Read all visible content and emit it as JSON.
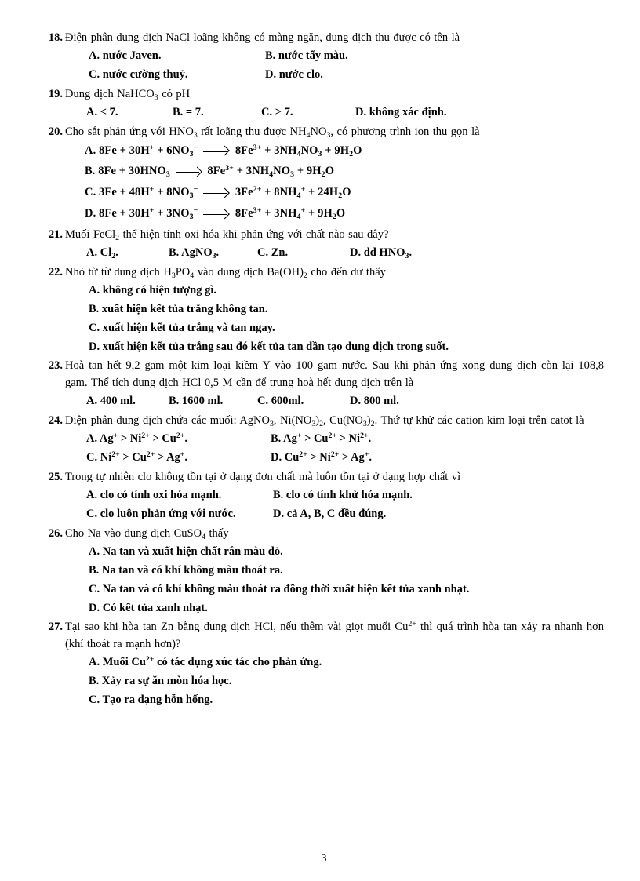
{
  "document": {
    "page_number": "3",
    "language": "vi"
  },
  "questions": [
    {
      "number": "18.",
      "text": "Điện phân dung dịch NaCl loãng không có màng ngăn, dung dịch thu được có tên là",
      "layout": "2col",
      "options": [
        "A. nước Javen.",
        "B. nước tẩy màu.",
        "C. nước cường thuỷ.",
        "D. nước clo."
      ]
    },
    {
      "number": "19.",
      "text_html": "Dung dịch NaHCO<sub>3</sub> có pH",
      "layout": "4col",
      "options": [
        "A. < 7.",
        "B. = 7.",
        "C. > 7.",
        "D. không xác định."
      ]
    },
    {
      "number": "20.",
      "text_html": "Cho sắt phản ứng với HNO<sub>3</sub> rất loãng thu được NH<sub>4</sub>NO<sub>3</sub>, có phương trình ion thu gọn là",
      "layout": "equations",
      "options_html": [
        "A.  8Fe + 30H<sup>+</sup> + 6NO<sub>3</sub><sup>−</sup> <span class=\"arrow\"></span> 8Fe<sup>3+</sup> + 3NH<sub>4</sub>NO<sub>3</sub> + 9H<sub>2</sub>O",
        "B.  8Fe + 30HNO<sub>3</sub> <span class=\"arrow short\"></span> 8Fe<sup>3+</sup> + 3NH<sub>4</sub>NO<sub>3</sub> + 9H<sub>2</sub>O",
        "C.  3Fe + 48H<sup>+</sup> + 8NO<sub>3</sub><sup>−</sup> <span class=\"arrow\"></span> 3Fe<sup>2+</sup> + 8NH<sub>4</sub><sup>+</sup> + 24H<sub>2</sub>O",
        "D.  8Fe + 30H<sup>+</sup> + 3NO<sub>3</sub><sup>−</sup> <span class=\"arrow\"></span> 8Fe<sup>3+</sup> + 3NH<sub>4</sub><sup>+</sup> + 9H<sub>2</sub>O"
      ]
    },
    {
      "number": "21.",
      "text_html": "Muối FeCl<sub>2</sub> thể hiện tính oxi hóa khi phản ứng với chất nào sau đây?",
      "layout": "4col-tight",
      "options_html": [
        "A. Cl<sub>2</sub>.",
        "B. AgNO<sub>3</sub>.",
        "C. Zn.",
        "D. dd HNO<sub>3</sub>."
      ]
    },
    {
      "number": "22.",
      "text_html": "Nhỏ từ từ dung dịch H<sub>3</sub>PO<sub>4</sub> vào dung dịch Ba(OH)<sub>2</sub> cho đến dư thấy",
      "layout": "1col",
      "options": [
        "A. không có hiện tượng gì.",
        "B. xuất hiện kết tủa trắng không tan.",
        "C. xuất hiện kết tủa trắng và tan ngay.",
        "D. xuất hiện kết tủa trắng sau đó kết tủa tan dần tạo dung dịch trong suốt."
      ]
    },
    {
      "number": "23.",
      "text": "Hoà tan hết 9,2 gam một kim loại kiềm Y vào 100 gam nước. Sau khi phản ứng xong dung dịch còn lại 108,8 gam. Thể tích dung dịch HCl 0,5 M cần để trung hoà hết dung dịch trên là",
      "layout": "4col-tight",
      "options": [
        "A. 400 ml.",
        "B. 1600 ml.",
        "C. 600ml.",
        "D. 800 ml."
      ]
    },
    {
      "number": "24.",
      "text_html": "Điện phân dung dịch chứa các muối:  AgNO<sub>3</sub>, Ni(NO<sub>3</sub>)<sub>2</sub>, Cu(NO<sub>3</sub>)<sub>2</sub>. Thứ tự khử các cation kim loại trên catot là",
      "layout": "2col-wide",
      "options_html": [
        "A. Ag<sup>+</sup> > Ni<sup>2+</sup> > Cu<sup>2+</sup>.",
        "B. Ag<sup>+</sup> > Cu<sup>2+</sup> > Ni<sup>2+</sup>.",
        "C. Ni<sup>2+</sup> > Cu<sup>2+</sup> > Ag<sup>+</sup>.",
        "D. Cu<sup>2+</sup> > Ni<sup>2+</sup> > Ag<sup>+</sup>."
      ]
    },
    {
      "number": "25.",
      "text": "Trong tự nhiên clo không tồn tại ở dạng đơn chất mà luôn tồn tại ở dạng hợp chất vì",
      "layout": "2col-narrow",
      "options": [
        "A. clo có tính oxi hóa mạnh.",
        "B. clo có tính khử hóa mạnh.",
        "C. clo luôn phản ứng với nước.",
        "D. cả A, B, C đều đúng."
      ]
    },
    {
      "number": "26.",
      "text_html": "Cho Na vào dung dịch CuSO<sub>4</sub> thấy",
      "layout": "1col",
      "options": [
        "A. Na tan và xuất hiện chất rắn màu đỏ.",
        "B. Na tan và có khí không màu thoát ra.",
        "C. Na tan và có khí không màu thoát ra đồng thời xuất hiện kết tủa xanh nhạt.",
        "D. Có kết tủa xanh nhạt."
      ]
    },
    {
      "number": "27.",
      "text_html": "Tại sao khi hòa tan Zn bằng dung dịch HCl, nếu thêm vài giọt muối Cu<sup>2+</sup> thì quá trình hòa tan xảy ra nhanh hơn (khí thoát ra mạnh hơn)?",
      "layout": "1col",
      "options_html": [
        "A. Muối Cu<sup>2+</sup> có tác dụng xúc tác cho phản ứng.",
        "B. Xảy ra sự ăn mòn hóa học.",
        "C. Tạo ra dạng hỗn hống."
      ]
    }
  ]
}
